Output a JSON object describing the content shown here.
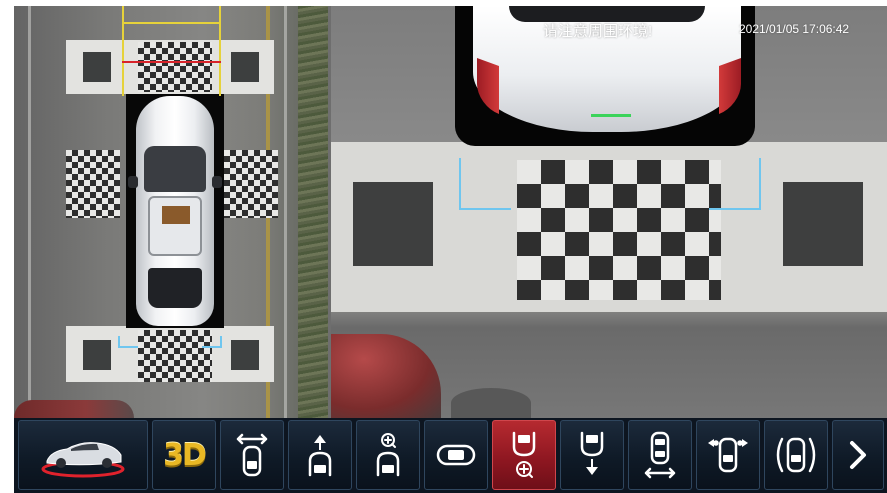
{
  "overlay": {
    "warning": "请注意周围环境!",
    "datetime": "2021/01/05  17:06:42"
  },
  "toolbar": {
    "buttons": [
      {
        "id": "car-model",
        "icon": "car-model-icon"
      },
      {
        "id": "3d-view",
        "label": "3D",
        "icon": "3d-icon"
      },
      {
        "id": "side-width",
        "icon": "car-width-arrows-icon"
      },
      {
        "id": "front-view",
        "icon": "front-camera-icon"
      },
      {
        "id": "front-zoom",
        "icon": "front-zoom-icon"
      },
      {
        "id": "panorama",
        "icon": "panorama-car-icon"
      },
      {
        "id": "rear-zoom",
        "icon": "rear-zoom-icon",
        "active": true
      },
      {
        "id": "rear-view",
        "icon": "rear-camera-icon"
      },
      {
        "id": "length-view",
        "icon": "car-length-icon"
      },
      {
        "id": "corner-view",
        "icon": "corner-camera-icon"
      },
      {
        "id": "radar-view",
        "icon": "radar-car-icon"
      },
      {
        "id": "next",
        "icon": "chevron-right-icon"
      }
    ]
  },
  "colors": {
    "active_button": "#b62a30",
    "toolbar_bg": "#0d1520",
    "icon_white": "#ffffff",
    "threed_gold": "#e9b824"
  }
}
